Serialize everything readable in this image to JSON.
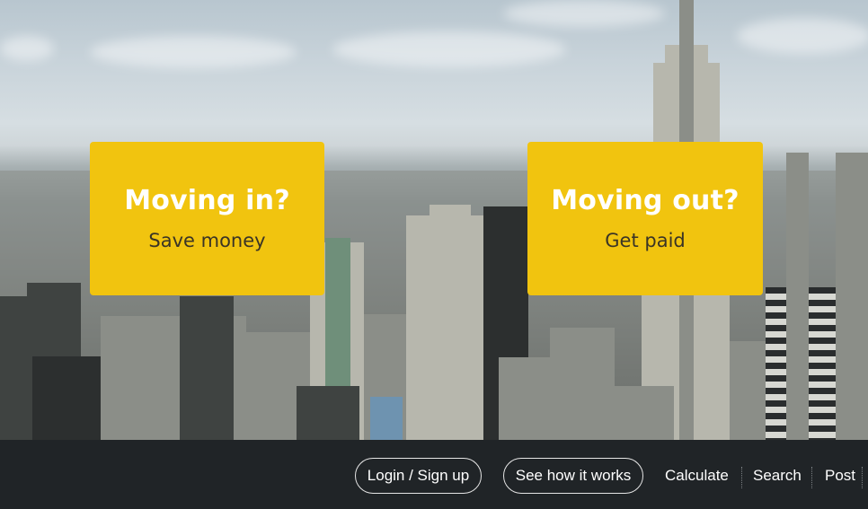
{
  "hero": {
    "image": "city-skyline-photo"
  },
  "cards": {
    "moving_in": {
      "title": "Moving in?",
      "subtitle": "Save money"
    },
    "moving_out": {
      "title": "Moving out?",
      "subtitle": "Get paid"
    },
    "background_color": "#f1c40f"
  },
  "nav": {
    "login_label": "Login / Sign up",
    "how_label": "See how it works",
    "calculate_label": "Calculate",
    "search_label": "Search",
    "post_label": "Post",
    "background_color": "#202427"
  }
}
